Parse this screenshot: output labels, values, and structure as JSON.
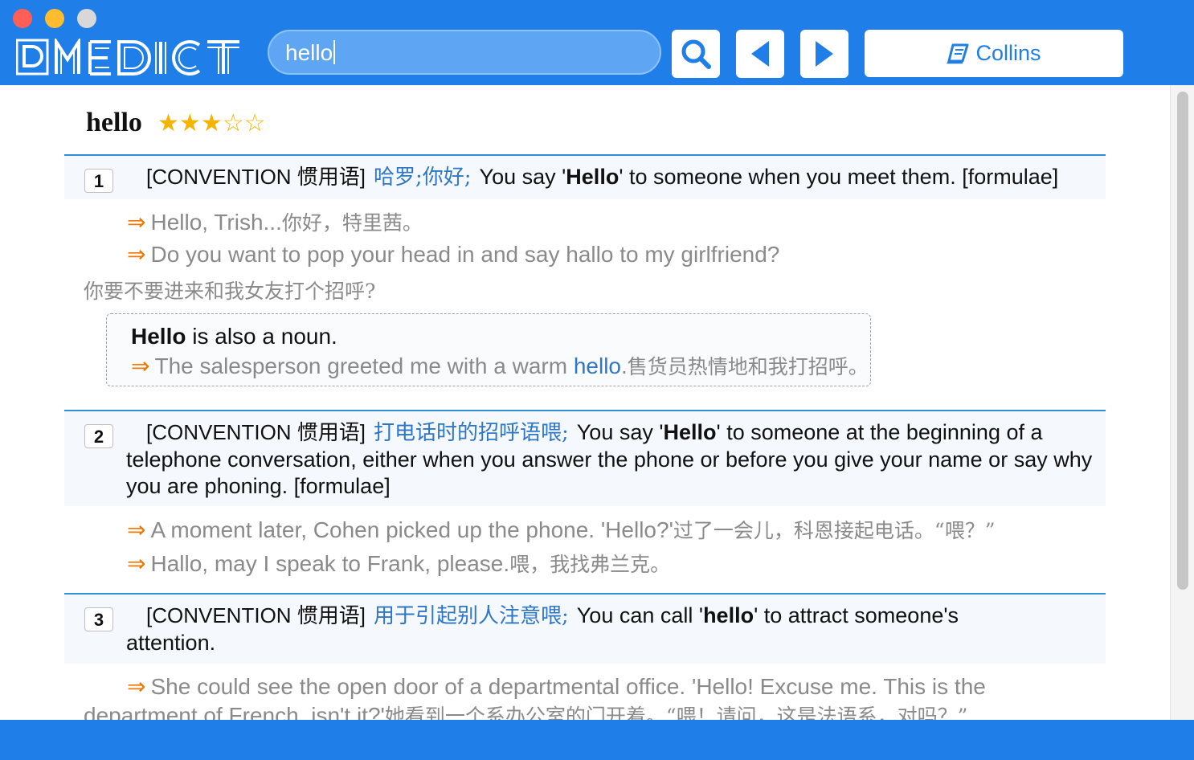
{
  "window": {
    "controls": [
      {
        "name": "close",
        "color": "#ff5f57"
      },
      {
        "name": "minimize",
        "color": "#febc2e"
      },
      {
        "name": "zoom",
        "color": "#d8d8d8"
      }
    ]
  },
  "app": {
    "logo_text": "MEDICT",
    "accent": "#1f7ee8"
  },
  "search": {
    "value": "hello"
  },
  "toolbar": {
    "dictionary_label": "Collins"
  },
  "entry": {
    "headword": "hello",
    "rating": 3,
    "rating_max": 5,
    "senses": [
      {
        "number": "1",
        "grammar": "[CONVENTION 惯用语]",
        "zh_definition": "哈罗;你好;",
        "def_before": "You say '",
        "def_bold": "Hello",
        "def_after": "' to someone when you meet them. [formulae]",
        "examples": [
          {
            "en": "Hello, Trish...",
            "zh": "你好，特里茜。"
          },
          {
            "en": "Do you want to pop your head in and say hallo to my girlfriend?",
            "zh": "你要不要进来和我女友打个招呼?"
          }
        ],
        "note": {
          "bold": "Hello",
          "text": " is also a noun.",
          "example_before": "The salesperson greeted me with a warm ",
          "example_highlight": "hello",
          "example_after": ".",
          "example_zh": "售货员热情地和我打招呼。"
        }
      },
      {
        "number": "2",
        "grammar": "[CONVENTION 惯用语]",
        "zh_definition": "打电话时的招呼语喂;",
        "def_before": "You say '",
        "def_bold": "Hello",
        "def_after": "' to someone at the beginning of a telephone conversation, either when you answer the phone or before you give your name or say why you are phoning. [formulae]",
        "examples": [
          {
            "en": "A moment later, Cohen picked up the phone. 'Hello?'",
            "zh": "过了一会儿，科恩接起电话。“喂？”"
          },
          {
            "en": "Hallo, may I speak to Frank, please.",
            "zh": "喂，我找弗兰克。"
          }
        ]
      },
      {
        "number": "3",
        "grammar": "[CONVENTION 惯用语]",
        "zh_definition": "用于引起别人注意喂;",
        "def_before": "You can call '",
        "def_bold": "hello",
        "def_after": "' to attract someone's attention.",
        "examples": [
          {
            "en": "She could see the open door of a departmental office. 'Hello! Excuse me. This is the department of French, isn't it?'",
            "zh": "她看到一个系办公室的门开着。“喂！请问，这是法语系，对吗？”"
          }
        ]
      }
    ]
  }
}
